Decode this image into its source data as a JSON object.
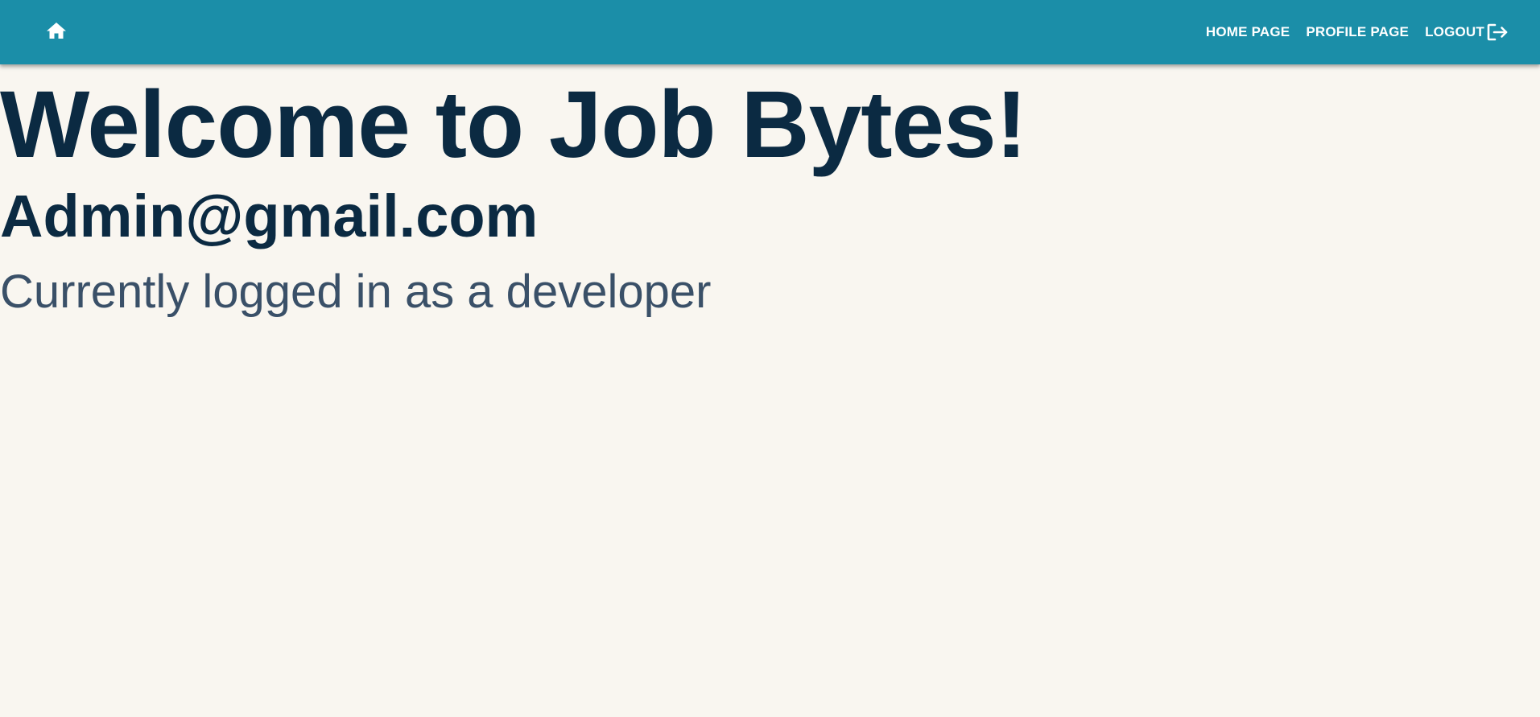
{
  "appbar": {
    "home_icon": "home-icon",
    "nav": {
      "home_label": "HOME PAGE",
      "profile_label": "PROFILE PAGE",
      "logout_label": "LOGOUT",
      "logout_icon": "logout-icon"
    }
  },
  "main": {
    "title": "Welcome to Job Bytes!",
    "email": "Admin@gmail.com",
    "role_text": "Currently logged in as a developer"
  },
  "colors": {
    "appbar_bg": "#1b8ea8",
    "page_bg": "#f9f6f0",
    "heading": "#0b2a42",
    "subtext": "#3a5068"
  }
}
